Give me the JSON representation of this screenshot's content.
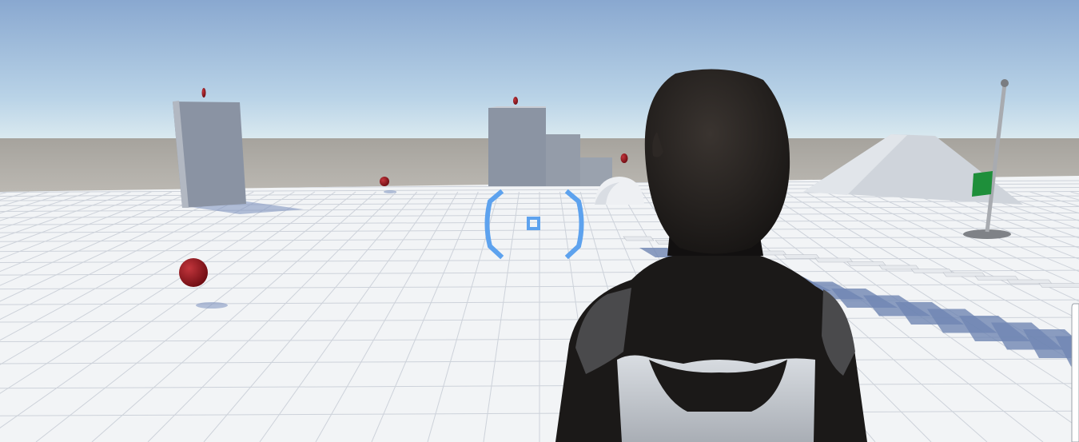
{
  "scene": {
    "sky_top": "#8aa9d0",
    "sky_horizon": "#d7e9f2",
    "ground_far": "#b3b0aa",
    "floor_color": "#f3f5f7",
    "grid_color": "#c9ced6",
    "block_face": "#8a93a3",
    "block_side": "#d3d7dc",
    "collectible_color": "#8e1219",
    "flag_color": "#1e8f3a",
    "shadow_color": "#6f86b3"
  },
  "hud": {
    "crosshair_color": "#5da2ee"
  },
  "player": {
    "suit_color": "#1b1918",
    "armor_color": "#cfd3d8"
  }
}
